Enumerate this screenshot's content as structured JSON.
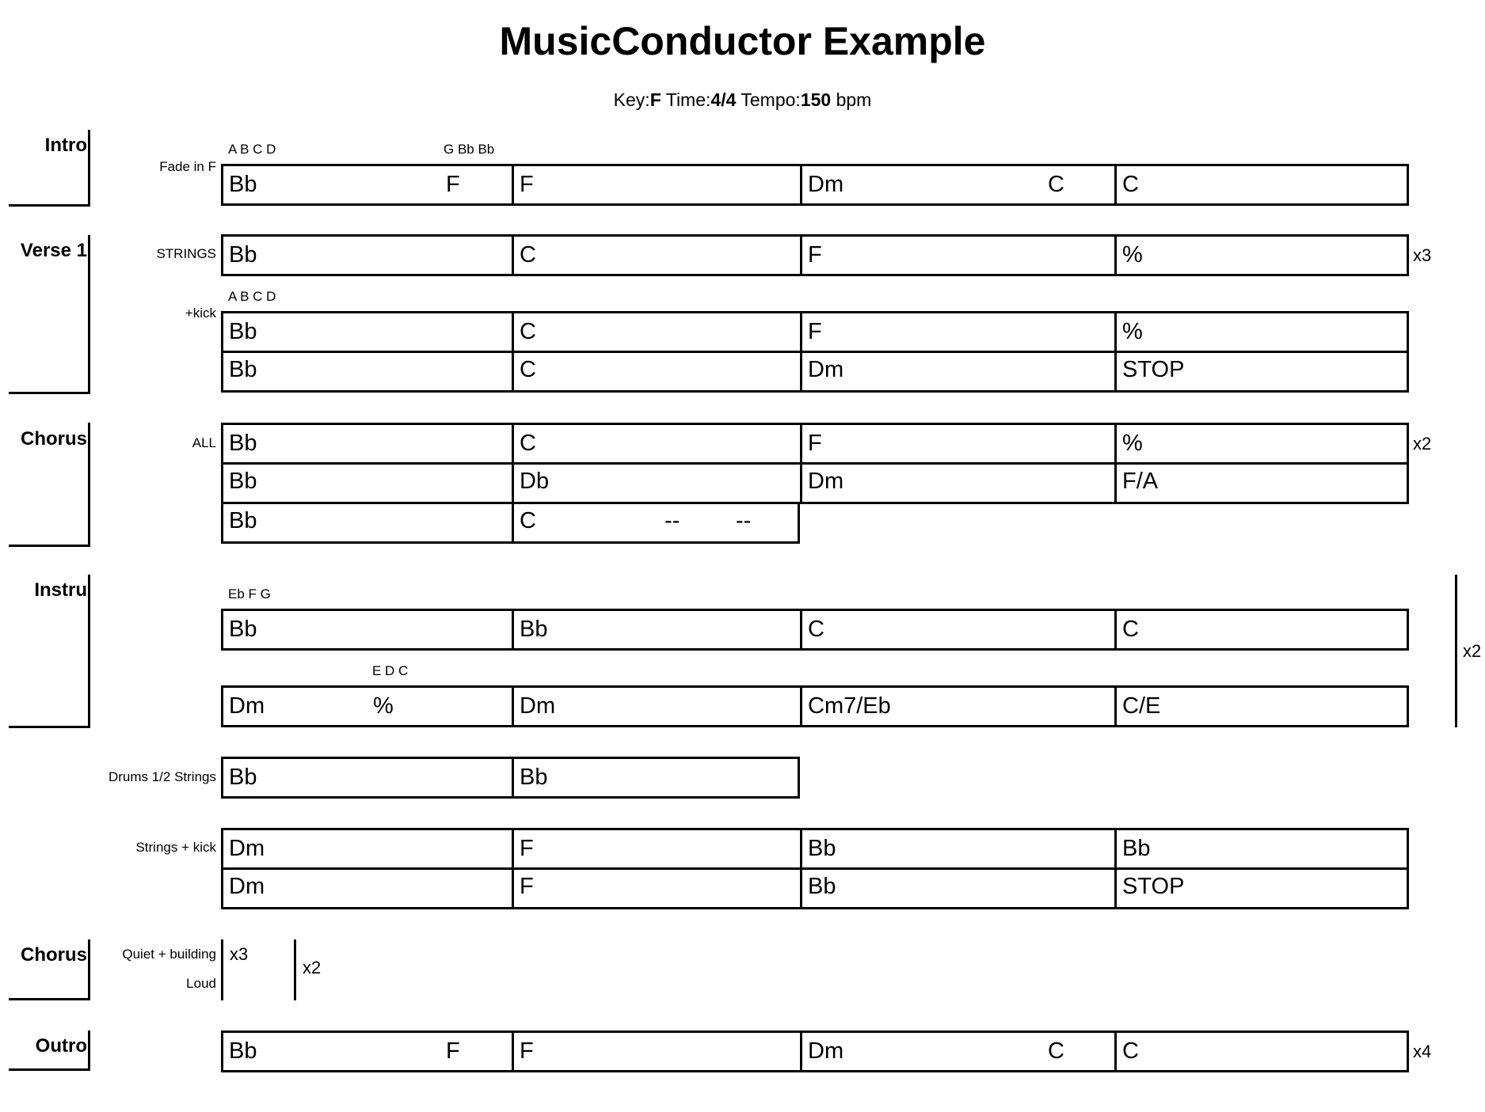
{
  "title": "MusicConductor Example",
  "meta": {
    "key_label": "Key:",
    "key": "F",
    "time_label": "Time:",
    "time": "4/4",
    "tempo_label": "Tempo:",
    "tempo": "150",
    "tempo_unit": "bpm"
  },
  "sections": {
    "intro": "Intro",
    "verse1": "Verse 1",
    "chorus": "Chorus",
    "instru": "Instru",
    "chorus2": "Chorus",
    "outro": "Outro"
  },
  "labels": {
    "fade_in": "Fade in F",
    "strings": "STRINGS",
    "kick": "+kick",
    "all": "ALL",
    "drums": "Drums 1/2 Strings",
    "strings_kick": "Strings + kick",
    "quiet": "Quiet + building",
    "loud": "Loud"
  },
  "annotations": {
    "intro_a": "A B C D",
    "intro_b": "G Bb Bb",
    "verse_kick": "A B C D",
    "instru_a": "Eb F G",
    "instru_b": "E D C"
  },
  "repeats": {
    "verse_strings": "x3",
    "chorus_all": "x2",
    "instru": "x2",
    "chorus2_quiet": "x3",
    "chorus2_loud": "x2",
    "outro": "x4"
  },
  "rows": {
    "intro": [
      "Bb",
      "F",
      "F",
      "Dm",
      "C",
      "C"
    ],
    "verse_a": [
      "Bb",
      "C",
      "F",
      "%"
    ],
    "verse_b": [
      "Bb",
      "C",
      "F",
      "%"
    ],
    "verse_c": [
      "Bb",
      "C",
      "Dm",
      "STOP"
    ],
    "chorus_a": [
      "Bb",
      "C",
      "F",
      "%"
    ],
    "chorus_b": [
      "Bb",
      "Db",
      "Dm",
      "F/A"
    ],
    "chorus_c": [
      "Bb",
      "C",
      "--",
      "--"
    ],
    "instru_a": [
      "Bb",
      "Bb",
      "C",
      "C"
    ],
    "instru_b": [
      "Dm",
      "%",
      "Dm",
      "Cm7/Eb",
      "C/E"
    ],
    "drums": [
      "Bb",
      "Bb"
    ],
    "sk_a": [
      "Dm",
      "F",
      "Bb",
      "Bb"
    ],
    "sk_b": [
      "Dm",
      "F",
      "Bb",
      "STOP"
    ],
    "outro": [
      "Bb",
      "F",
      "F",
      "Dm",
      "C",
      "C"
    ]
  }
}
